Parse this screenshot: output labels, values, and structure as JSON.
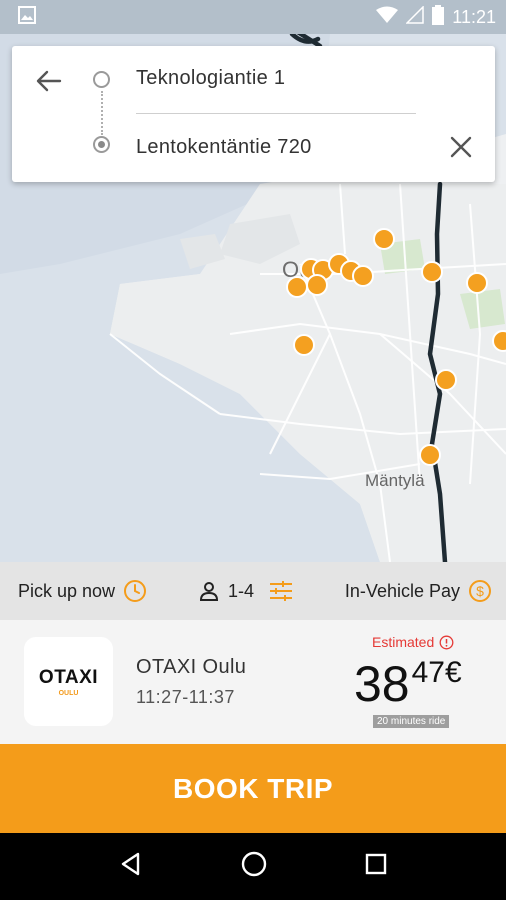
{
  "status_bar": {
    "time": "11:21",
    "icons": [
      "image-icon",
      "wifi-icon",
      "signal-icon",
      "battery-icon"
    ]
  },
  "route": {
    "origin": "Teknologiantie 1",
    "destination": "Lentokentäntie 720"
  },
  "map": {
    "labels": {
      "city": "Oulu",
      "district": "Mäntylä"
    },
    "colors": {
      "land": "#eef0f2",
      "water": "#cfd9e5",
      "road": "#ffffff",
      "route": "#1f2b33",
      "marker": "#f4a020",
      "park": "#d7e8cf"
    }
  },
  "options": {
    "pickup": "Pick up now",
    "passengers": "1-4",
    "payment": "In-Vehicle Pay"
  },
  "provider": {
    "logo_text": "OTAXI",
    "logo_sub": "OULU",
    "name": "OTAXI Oulu",
    "time_window": "11:27-11:37",
    "estimated_label": "Estimated",
    "price_main": "38",
    "price_decimal": "47€",
    "ride_duration": "20 minutes ride"
  },
  "actions": {
    "book_label": "BOOK TRIP"
  },
  "accent_color": "#f49c1a"
}
